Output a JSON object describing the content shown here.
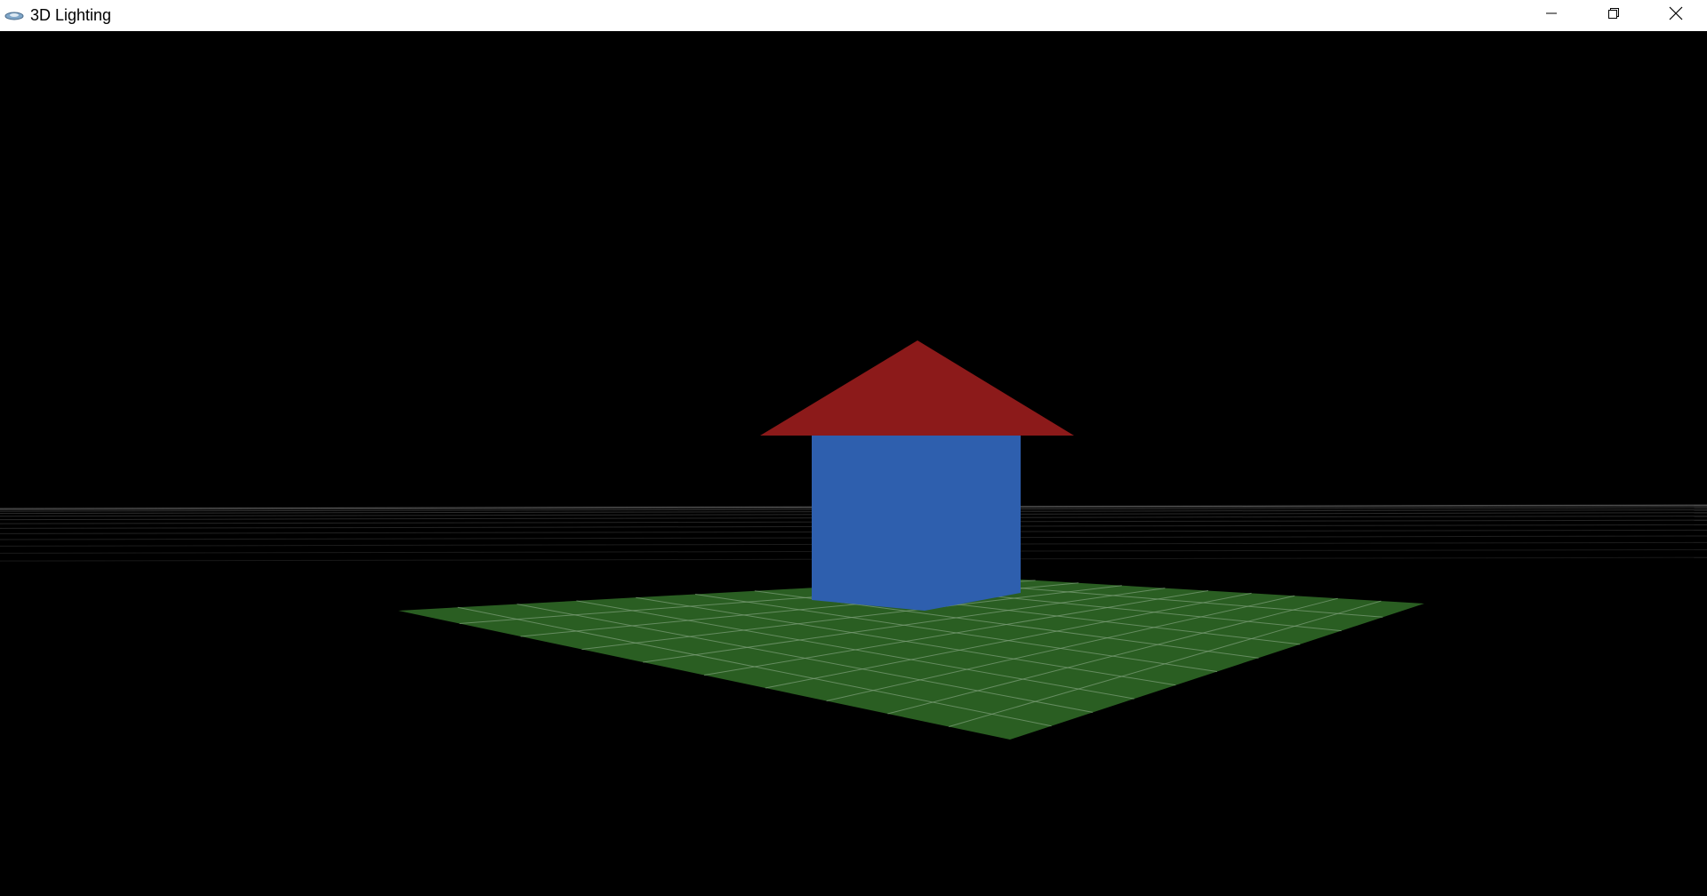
{
  "window": {
    "title": "3D Lighting",
    "controls": {
      "minimize_icon": "minimize-icon",
      "restore_icon": "restore-icon",
      "close_icon": "close-icon"
    }
  },
  "scene": {
    "background_color": "#000000",
    "grid_color": "#9a9a9a",
    "ground_plane_color": "#2a5e22",
    "house_walls_color": "#2e5fae",
    "house_roof_color": "#8c1a1a",
    "objects": [
      "ground-grid",
      "ground-plane",
      "house-walls",
      "house-roof"
    ]
  }
}
